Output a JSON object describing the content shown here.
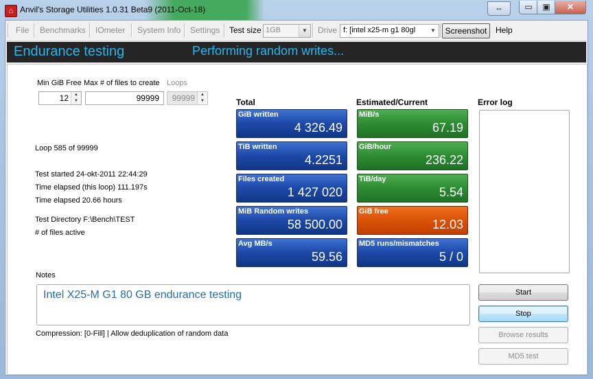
{
  "window": {
    "title": "Anvil's Storage Utilities 1.0.31 Beta9 (2011-Oct-18)",
    "icon": "anvil-app-icon",
    "controls": {
      "extra": "⇔",
      "minimize": "▭",
      "maximize": "▣",
      "close": "✕"
    }
  },
  "menubar": {
    "file": "File",
    "benchmarks": "Benchmarks",
    "iometer": "IOmeter",
    "system_info": "System Info",
    "settings": "Settings",
    "test_size_label": "Test size",
    "test_size_value": "1GB",
    "drive_label": "Drive",
    "drive_value": "f: [intel x25-m g1 80gl",
    "screenshot": "Screenshot",
    "help": "Help"
  },
  "header": {
    "title": "Endurance testing",
    "status": "Performing random writes..."
  },
  "params": {
    "min_gib_free_label": "Min GiB Free",
    "min_gib_free_value": "12",
    "max_files_label": "Max # of files to create",
    "max_files_value": "99999",
    "loops_label": "Loops",
    "loops_value": "99999"
  },
  "info": {
    "loop": "Loop 585 of 99999",
    "test_started": "Test started 24-okt-2011 22:44:29",
    "elapsed_loop": "Time elapsed (this loop) 111.197s",
    "elapsed_total": "Time elapsed 20.66 hours",
    "test_directory": "Test Directory F:\\Bench\\TEST",
    "files_active": "# of files active"
  },
  "total": {
    "heading": "Total",
    "tiles": [
      {
        "label": "GiB written",
        "value": "4 326.49",
        "color": "blue"
      },
      {
        "label": "TiB written",
        "value": "4.2251",
        "color": "blue"
      },
      {
        "label": "Files created",
        "value": "1 427 020",
        "color": "blue"
      },
      {
        "label": "MiB Random writes",
        "value": "58 500.00",
        "color": "blue"
      },
      {
        "label": "Avg MB/s",
        "value": "59.56",
        "color": "blue"
      }
    ]
  },
  "estimated": {
    "heading": "Estimated/Current",
    "tiles": [
      {
        "label": "MiB/s",
        "value": "67.19",
        "color": "green"
      },
      {
        "label": "GiB/hour",
        "value": "236.22",
        "color": "green"
      },
      {
        "label": "TiB/day",
        "value": "5.54",
        "color": "green"
      },
      {
        "label": "GiB free",
        "value": "12.03",
        "color": "orange"
      },
      {
        "label": "MD5 runs/mismatches",
        "value": "5 / 0",
        "color": "blue"
      }
    ]
  },
  "error_log": {
    "heading": "Error log"
  },
  "notes": {
    "label": "Notes",
    "text": "Intel X25-M G1 80 GB endurance testing",
    "compression": "Compression: [0-Fill] | Allow deduplication of random data"
  },
  "buttons": {
    "start": "Start",
    "stop": "Stop",
    "browse_results": "Browse results",
    "md5_test": "MD5 test"
  },
  "colors": {
    "header_bg": "#252525",
    "header_text": "#29b5ee",
    "tile_blue": "#1d49a8",
    "tile_green": "#2d8c32",
    "tile_orange": "#dc5108"
  }
}
